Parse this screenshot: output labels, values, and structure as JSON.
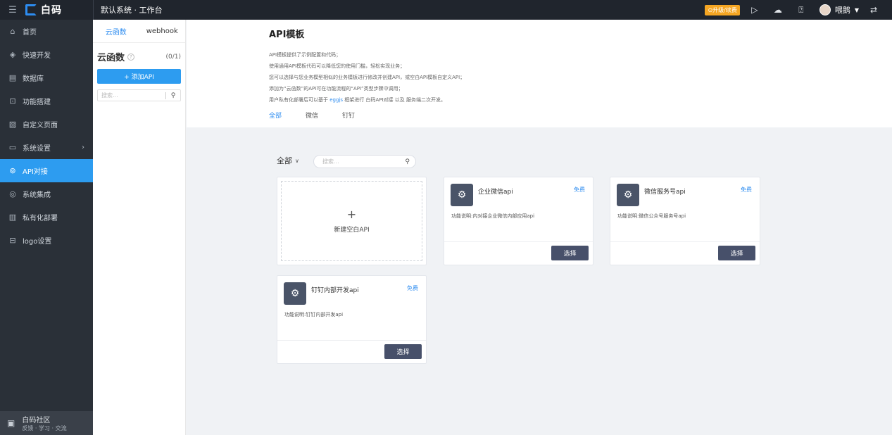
{
  "topbar": {
    "logo_text": "白码",
    "breadcrumb": "默认系统 · 工作台",
    "upgrade": "⊙升级/续费",
    "user_name": "喂鹅"
  },
  "sidebar": {
    "items": [
      {
        "label": "首页",
        "icon": "⌂"
      },
      {
        "label": "快速开发",
        "icon": "◈"
      },
      {
        "label": "数据库",
        "icon": "▤"
      },
      {
        "label": "功能搭建",
        "icon": "⊡"
      },
      {
        "label": "自定义页面",
        "icon": "▨"
      },
      {
        "label": "系统设置",
        "icon": "▭"
      },
      {
        "label": "API对接",
        "icon": "⊚"
      },
      {
        "label": "系统集成",
        "icon": "◎"
      },
      {
        "label": "私有化部署",
        "icon": "▥"
      },
      {
        "label": "logo设置",
        "icon": "⊟"
      }
    ],
    "community_title": "白码社区",
    "community_sub": "反馈 · 学习 · 交流"
  },
  "functions_panel": {
    "tab_cloud": "云函数",
    "tab_webhook": "webhook",
    "title": "云函数",
    "count": "(0/1)",
    "add_button": "+ 添加API",
    "search_placeholder": "搜索..."
  },
  "main": {
    "title": "API模板",
    "desc_lines": [
      "API模板提供了示例配置和代码；",
      "使用通用API模板代码可以降低您的使用门槛，轻松实现业务；",
      "您可以选择与您业务模型相似的业务模板进行修改并创建API，或空白API模板自定义API；",
      "添加为“云函数”的API可在功能流程的“API”类型步骤中调用；"
    ],
    "desc_last_prefix": "用户私有化部署后可以基于 ",
    "desc_last_link": "eggjs",
    "desc_last_suffix": " 框架进行 白码API对接 以及 服务端二次开发。",
    "tabs": [
      "全部",
      "微信",
      "钉钉"
    ],
    "filter_label": "全部",
    "search_placeholder": "搜索...",
    "new_card_label": "新建空白API",
    "templates": [
      {
        "name": "企业微信api",
        "badge": "免费",
        "desc": "功能说明:内对接企业微信内部应用api",
        "button": "选择"
      },
      {
        "name": "微信服务号api",
        "badge": "免费",
        "desc": "功能说明:微信公众号服务号api",
        "button": "选择"
      },
      {
        "name": "钉钉内部开发api",
        "badge": "免费",
        "desc": "功能说明:钉钉内部开发api",
        "button": "选择"
      }
    ]
  }
}
